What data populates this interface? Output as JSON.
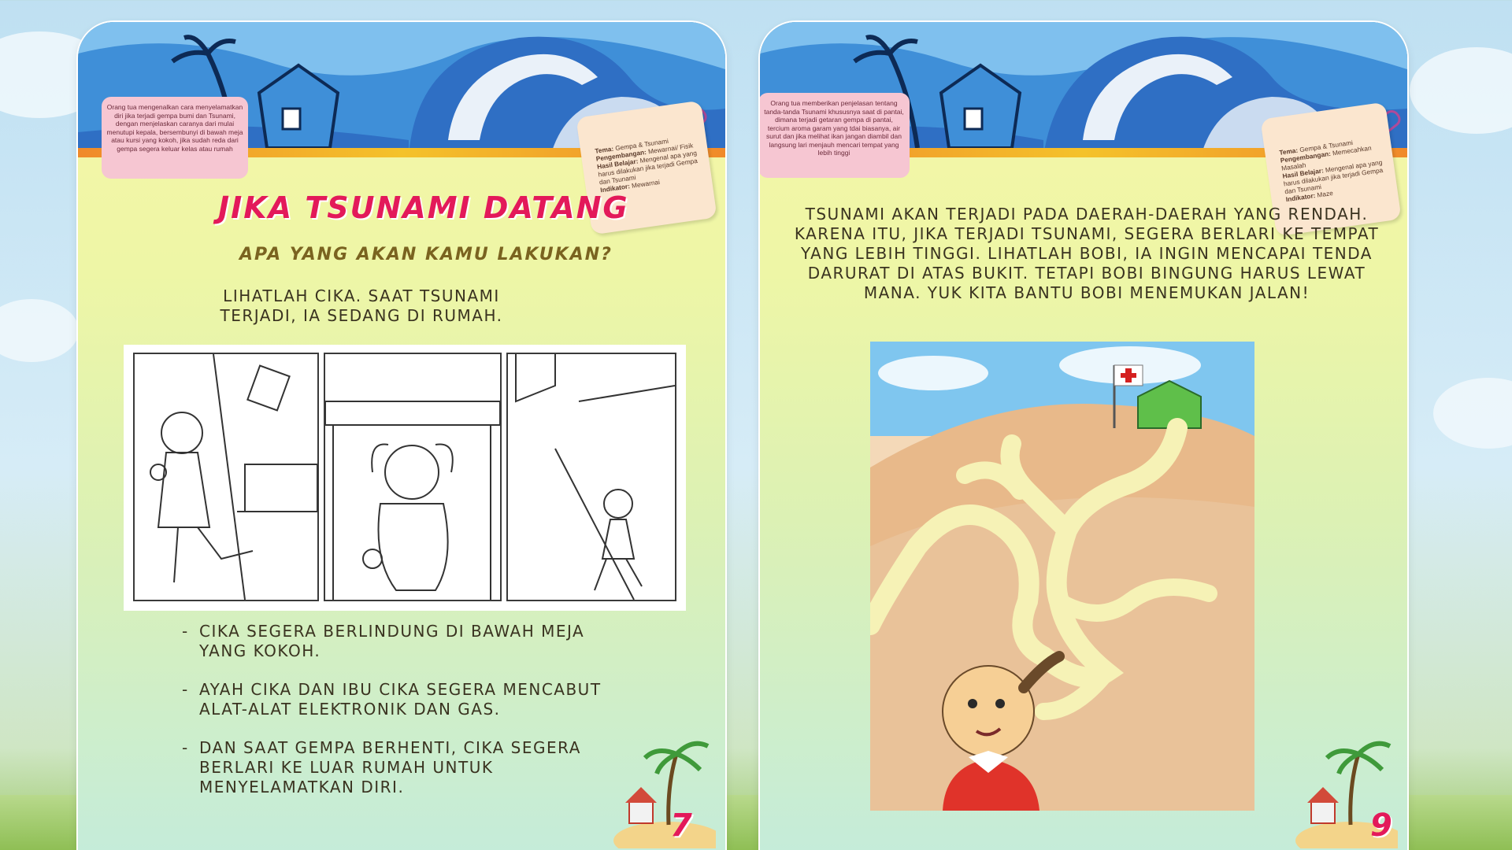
{
  "left_page": {
    "parent_note": "Orang tua mengenalkan cara menyelamatkan diri jika terjadi gempa bumi dan Tsunami, dengan menjelaskan caranya dari mulai menutupi kepala, bersembunyi di bawah meja atau kursi yang kokoh, jika sudah reda dari gempa segera keluar kelas atau rumah",
    "tag": {
      "tema_label": "Tema:",
      "tema_value": "Gempa & Tsunami",
      "pengembangan_label": "Pengembangan:",
      "pengembangan_value": "Mewarnai/ Fisik",
      "hasil_label": "Hasil Belajar:",
      "hasil_value": "Mengenal apa yang harus dilakukan jika terjadi Gempa dan Tsunami",
      "indikator_label": "Indikator:",
      "indikator_value": "Mewarnai"
    },
    "title": "JIKA TSUNAMI DATANG",
    "question": "APA YANG AKAN KAMU LAKUKAN?",
    "intro": "LIHATLAH CIKA. SAAT TSUNAMI TERJADI, IA SEDANG DI RUMAH.",
    "bullets": [
      "CIKA SEGERA BERLINDUNG DI BAWAH MEJA YANG KOKOH.",
      "AYAH CIKA DAN IBU CIKA SEGERA MENCABUT ALAT-ALAT ELEKTRONIK DAN GAS.",
      "DAN SAAT GEMPA BERHENTI, CIKA SEGERA BERLARI KE LUAR RUMAH UNTUK MENYELAMATKAN DIRI."
    ],
    "page_number": "7"
  },
  "right_page": {
    "parent_note": "Orang tua memberikan penjelasan tentang tanda-tanda Tsunami khususnya saat di pantai, dimana terjadi getaran gempa di pantai, tercium aroma garam yang tdai biasanya, air surut dan jika melihat ikan jangan diambil dan langsung lari menjauh mencari tempat yang lebih tinggi",
    "tag": {
      "tema_label": "Tema:",
      "tema_value": "Gempa & Tsunami",
      "pengembangan_label": "Pengembangan:",
      "pengembangan_value": "Memecahkan Masalah",
      "hasil_label": "Hasil Belajar:",
      "hasil_value": "Mengenal apa yang harus dilakukan jika terjadi Gempa dan Tsunami",
      "indikator_label": "Indikator:",
      "indikator_value": "Maze"
    },
    "intro": "TSUNAMI AKAN TERJADI PADA DAERAH-DAERAH YANG RENDAH. KARENA ITU, JIKA TERJADI TSUNAMI, SEGERA BERLARI KE TEMPAT YANG LEBIH TINGGI. LIHATLAH BOBI, IA INGIN MENCAPAI TENDA DARURAT DI ATAS BUKIT. TETAPI BOBI BINGUNG HARUS LEWAT MANA. YUK KITA BANTU BOBI MENEMUKAN JALAN!",
    "page_number": "9"
  },
  "colors": {
    "title_pink": "#e3195a",
    "sky_blue": "#3f8fd8",
    "wave_blue": "#2f6fc4",
    "page_yellow": "#f7f7a8",
    "note_pink": "#f6c6d2"
  }
}
